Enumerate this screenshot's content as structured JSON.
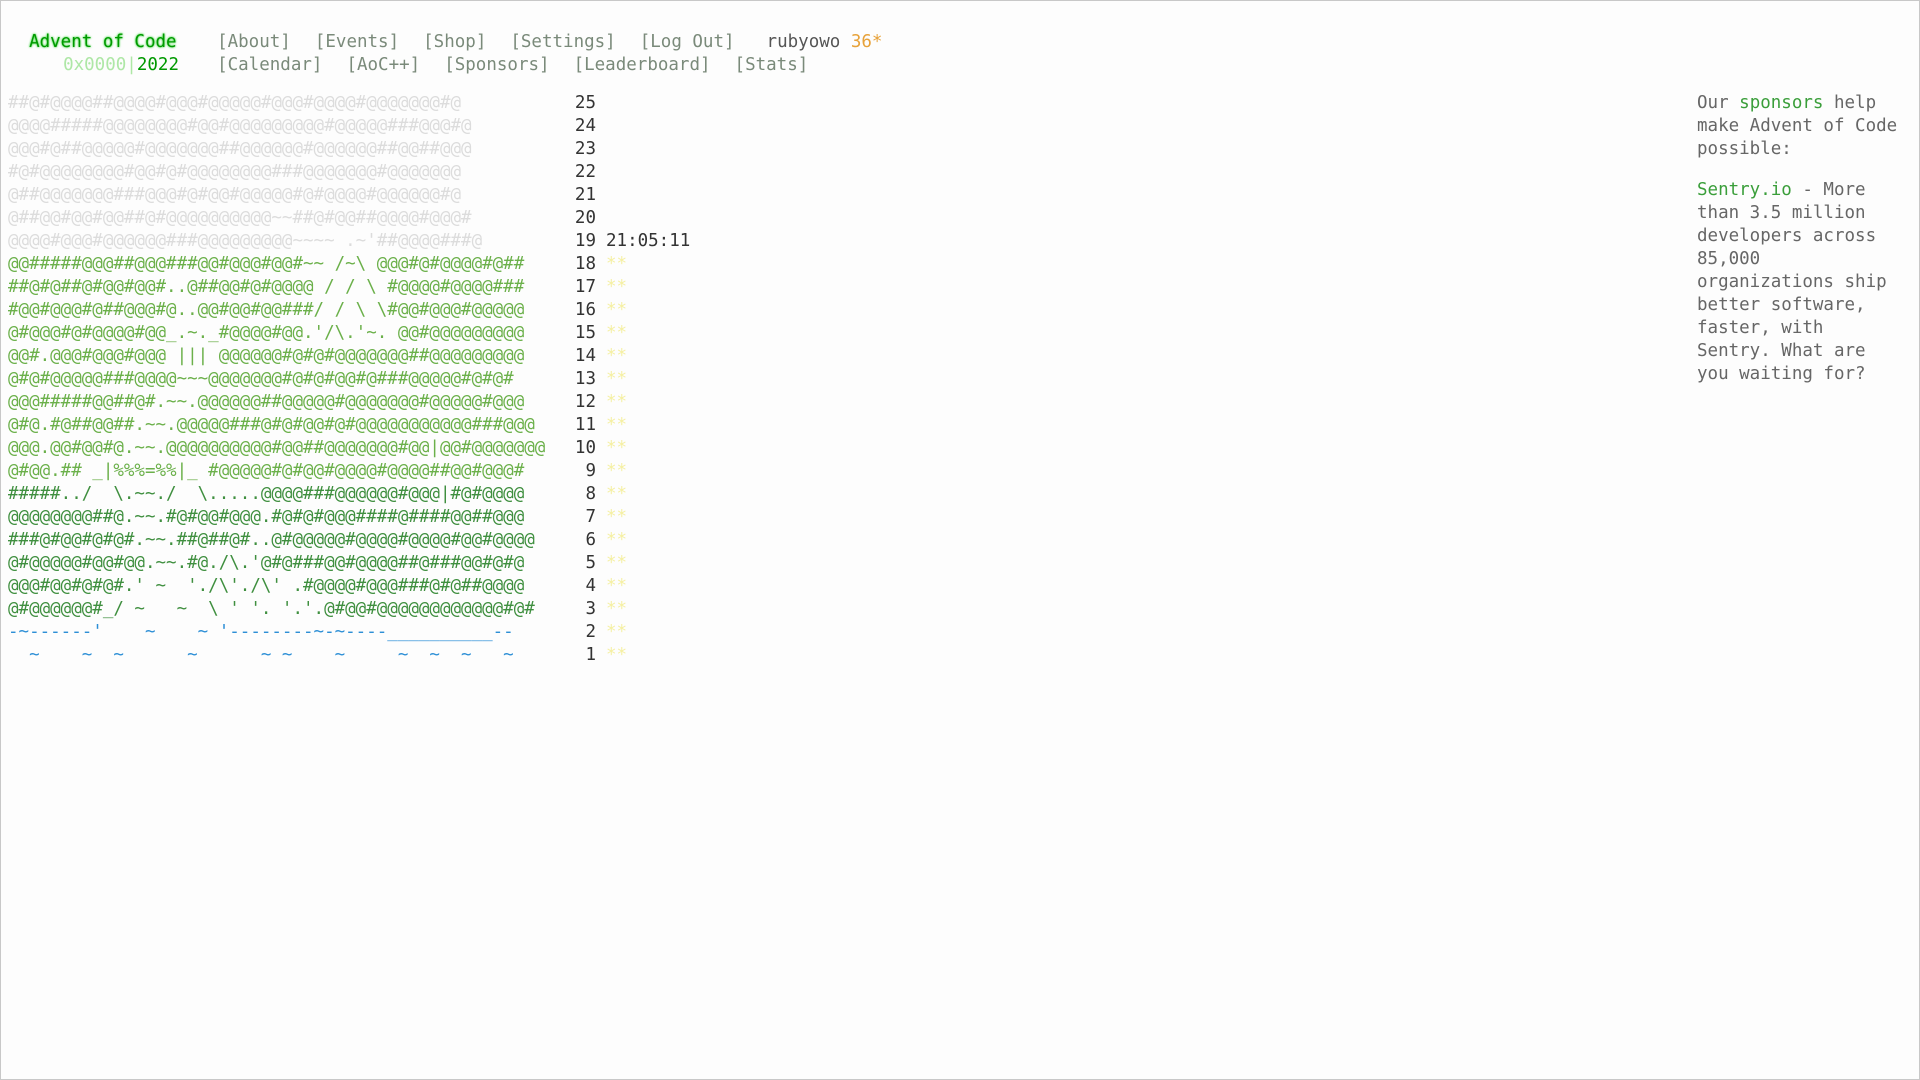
{
  "header": {
    "title": "Advent of Code",
    "nav": [
      "[About]",
      "[Events]",
      "[Shop]",
      "[Settings]",
      "[Log Out]"
    ],
    "user": "rubyowo",
    "stars": "36*",
    "year_prefix": "0x0000|",
    "year": "2022",
    "subnav": [
      "[Calendar]",
      "[AoC++]",
      "[Sponsors]",
      "[Leaderboard]",
      "[Stats]"
    ]
  },
  "calendar": {
    "rows": [
      {
        "art": "##@#@@@@##@@@@#@@@#@@@@@#@@@#@@@@#@@@@@@@#@",
        "day": "25",
        "time": "",
        "stars": ""
      },
      {
        "art": "@@@@#####@@@@@@@@#@@#@@@@@@@@@#@@@@@###@@@#@",
        "day": "24",
        "time": "",
        "stars": ""
      },
      {
        "art": "@@@#@##@@@@@#@@@@@@@##@@@@@@#@@@@@@##@@##@@@",
        "day": "23",
        "time": "",
        "stars": ""
      },
      {
        "art": "#@#@@@@@@@@#@@#@#@@@@@@@@###@@@@@@@#@@@@@@@",
        "day": "22",
        "time": "",
        "stars": ""
      },
      {
        "art": "@##@@@@@@@###@@@#@#@@#@@@@@#@#@@@@#@@@@@@#@",
        "day": "21",
        "time": "",
        "stars": ""
      },
      {
        "art": "@##@@#@@#@@##@#@@@@@@@@@@~~##@#@@##@@@@#@@@#",
        "day": "20",
        "time": "",
        "stars": ""
      },
      {
        "art": "@@@@#@@@#@@@@@@###@@@@@@@@@~~~~ .~'##@@@@###@",
        "day": "19",
        "time": "21:05:11",
        "stars": ""
      },
      {
        "art": "@@#####@@@##@@@###@@#@@@#@@#~~ /~\\ @@@#@#@@@@#@##",
        "day": "18",
        "time": "",
        "stars": "**"
      },
      {
        "art": "##@#@##@#@@#@@#..@##@@#@#@@@@ / / \\ #@@@@#@@@@###",
        "day": "17",
        "time": "",
        "stars": "**"
      },
      {
        "art": "#@@#@@@#@##@@@#@..@@#@@#@@###/ / \\ \\#@@#@@@#@@@@@",
        "day": "16",
        "time": "",
        "stars": "**"
      },
      {
        "art": "@#@@@#@#@@@@#@@_.~._#@@@@#@@.'/\\.'~. @@#@@@@@@@@@",
        "day": "15",
        "time": "",
        "stars": "**"
      },
      {
        "art": "@@#.@@@#@@@#@@@ ||| @@@@@@#@#@#@@@@@@@##@@@@@@@@@",
        "day": "14",
        "time": "",
        "stars": "**"
      },
      {
        "art": "@#@#@@@@@###@@@@~~~@@@@@@@#@#@#@@#@###@@@@@#@#@#",
        "day": "13",
        "time": "",
        "stars": "**"
      },
      {
        "art": "@@@#####@@##@#.~~.@@@@@@##@@@@@#@@@@@@@#@@@@@#@@@",
        "day": "12",
        "time": "",
        "stars": "**"
      },
      {
        "art": "@#@.#@##@@##.~~.@@@@@###@#@#@@#@#@@@@@@@@@@@###@@@",
        "day": "11",
        "time": "",
        "stars": "**"
      },
      {
        "art": "@@@.@@#@@#@.~~.@@@@@@@@@@#@@##@@@@@@@#@@|@@#@@@@@@@",
        "day": "10",
        "time": "",
        "stars": "**"
      },
      {
        "art": "@#@@.## _|%%%=%%|_ #@@@@@#@#@@#@@@@#@@@@##@@#@@@#",
        "day": "9",
        "time": "",
        "stars": "**"
      },
      {
        "art": "#####../  \\.~~./  \\.....@@@@###@@@@@@#@@@|#@#@@@@",
        "day": "8",
        "time": "",
        "stars": "**"
      },
      {
        "art": "@@@@@@@@##@.~~.#@#@@#@@@.#@#@#@@@####@####@@##@@@",
        "day": "7",
        "time": "",
        "stars": "**"
      },
      {
        "art": "###@#@@#@#@#.~~.##@##@#..@#@@@@@#@@@@#@@@@#@@#@@@@",
        "day": "6",
        "time": "",
        "stars": "**"
      },
      {
        "art": "@#@@@@@#@@#@@.~~.#@./\\.'@#@###@@#@@@@##@###@@#@#@",
        "day": "5",
        "time": "",
        "stars": "**"
      },
      {
        "art": "@@@#@@#@#@#.' ~  './\\'./\\' .#@@@@#@@@###@#@##@@@@",
        "day": "4",
        "time": "",
        "stars": "**"
      },
      {
        "art": "@#@@@@@@#_/ ~   ~  \\ ' '. '.'.@#@@#@@@@@@@@@@@@#@#",
        "day": "3",
        "time": "",
        "stars": "**"
      },
      {
        "art": "-~------'    ~    ~ '--------~-~----__________--",
        "day": "2",
        "time": "",
        "stars": "**"
      },
      {
        "art": "  ~    ~  ~      ~      ~ ~    ~     ~  ~  ~   ~",
        "day": "1",
        "time": "",
        "stars": "**"
      }
    ]
  },
  "sidebar": {
    "intro_before": "Our ",
    "intro_link": "sponsors",
    "intro_after": " help make Advent of Code possible:",
    "sponsor_name": "Sentry.io",
    "sponsor_text": " - More than 3.5 million developers across 85,000 organizations ship better software, faster, with Sentry. What are you waiting for?"
  },
  "colors": {
    "title_green": "#009900",
    "star_gold": "#e7a23a",
    "water_blue": "#2d8fd6",
    "faint_star": "#f5f0a2"
  }
}
